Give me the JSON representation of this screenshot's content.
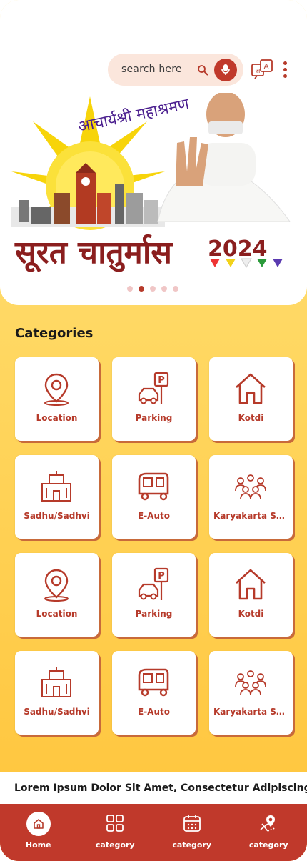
{
  "search": {
    "placeholder": "search here"
  },
  "icons": {
    "search": "search-icon",
    "mic": "mic-icon",
    "translate": "translate-icon",
    "menu": "kebab-menu-icon"
  },
  "banner": {
    "top_text": "आचार्यश्री महाश्रमण",
    "title_text": "सूरत चातुर्मास",
    "year": "2024"
  },
  "carousel": {
    "total": 5,
    "active": 1
  },
  "categories": {
    "title": "Categories",
    "items": [
      {
        "label": "Location",
        "icon": "location-pin-icon"
      },
      {
        "label": "Parking",
        "icon": "parking-icon"
      },
      {
        "label": "Kotdi",
        "icon": "house-icon"
      },
      {
        "label": "Sadhu/Sadhvi",
        "icon": "temple-icon"
      },
      {
        "label": "E-Auto",
        "icon": "auto-rickshaw-icon"
      },
      {
        "label": "Karyakarta Seva",
        "icon": "people-group-icon"
      },
      {
        "label": "Location",
        "icon": "location-pin-icon"
      },
      {
        "label": "Parking",
        "icon": "parking-icon"
      },
      {
        "label": "Kotdi",
        "icon": "house-icon"
      },
      {
        "label": "Sadhu/Sadhvi",
        "icon": "temple-icon"
      },
      {
        "label": "E-Auto",
        "icon": "auto-rickshaw-icon"
      },
      {
        "label": "Karyakarta Seva",
        "icon": "people-group-icon"
      }
    ]
  },
  "ticker": {
    "text": "Lorem Ipsum Dolor Sit Amet, Consectetur Adipiscing Elit"
  },
  "nav": {
    "items": [
      {
        "label": "Home",
        "icon": "home-icon"
      },
      {
        "label": "category",
        "icon": "grid-icon"
      },
      {
        "label": "category",
        "icon": "calendar-icon"
      },
      {
        "label": "category",
        "icon": "map-pin-icon"
      }
    ]
  },
  "colors": {
    "accent": "#c0392b",
    "banner_title": "#8b1e1e",
    "gradient_top": "#ffe27e",
    "gradient_bottom": "#ffc43a"
  }
}
